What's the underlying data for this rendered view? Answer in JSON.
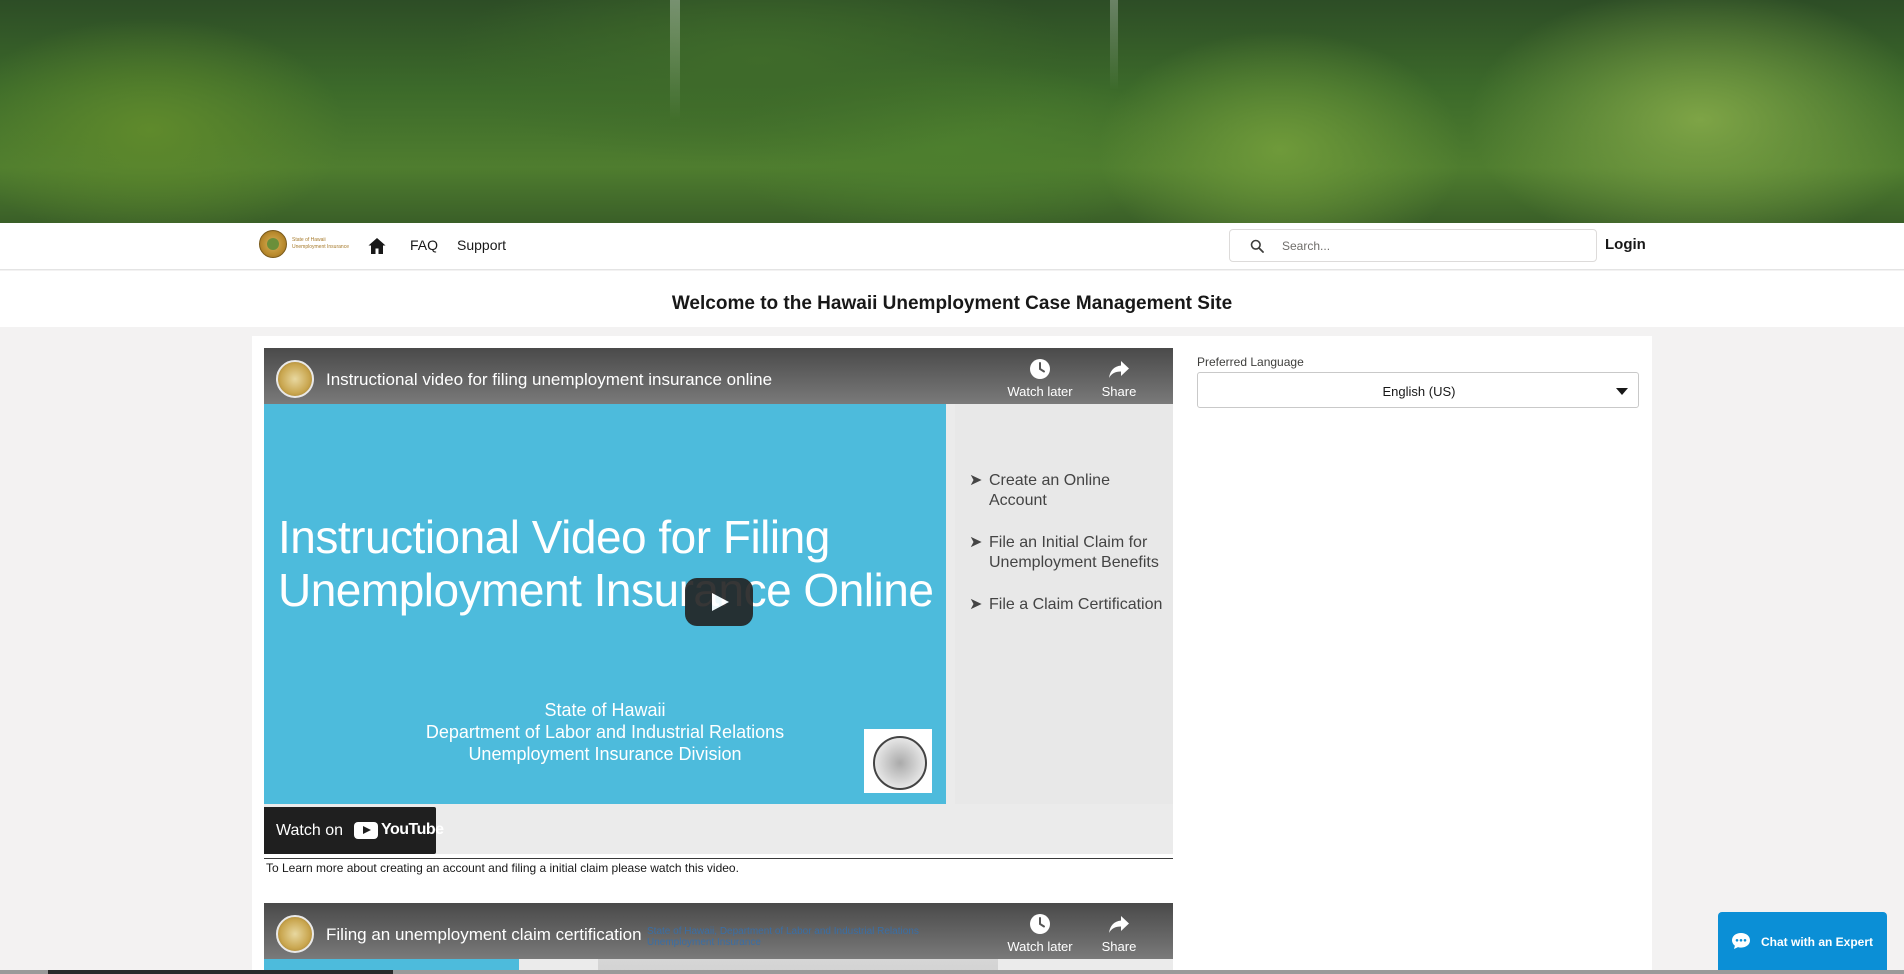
{
  "nav": {
    "logo_line1": "State of Hawaii",
    "logo_line2": "Unemployment Insurance",
    "faq": "FAQ",
    "support": "Support",
    "search_placeholder": "Search...",
    "login": "Login"
  },
  "welcome": {
    "title": "Welcome to the Hawaii Unemployment Case Management Site"
  },
  "video1": {
    "title": "Instructional video for filing unemployment insurance online",
    "watch_later": "Watch later",
    "share": "Share",
    "slide_title_line1": "Instructional Video for Filing",
    "slide_title_line2": "Unemployment Insurance Online",
    "slide_sub_line1": "State of Hawaii",
    "slide_sub_line2": "Department of Labor and Industrial Relations",
    "slide_sub_line3": "Unemployment Insurance Division",
    "bullets": [
      "Create an Online Account",
      "File an Initial Claim for Unemployment Benefits",
      "File a Claim Certification"
    ],
    "watch_on": "Watch on",
    "youtube": "YouTube"
  },
  "caption": "To Learn more about creating an account and filing a initial claim please watch this video.",
  "video2": {
    "title": "Filing an unemployment claim certification",
    "watch_later": "Watch later",
    "share": "Share",
    "ghost_line1": "State of Hawaii, Department of Labor and Industrial Relations",
    "ghost_line2": "Unemployment Insurance"
  },
  "preferred_language": {
    "label": "Preferred Language",
    "value": "English (US)"
  },
  "chat": {
    "label": "Chat with an Expert"
  },
  "colors": {
    "slide_blue": "#4dbbdc",
    "chat_blue": "#0b8fd6"
  }
}
